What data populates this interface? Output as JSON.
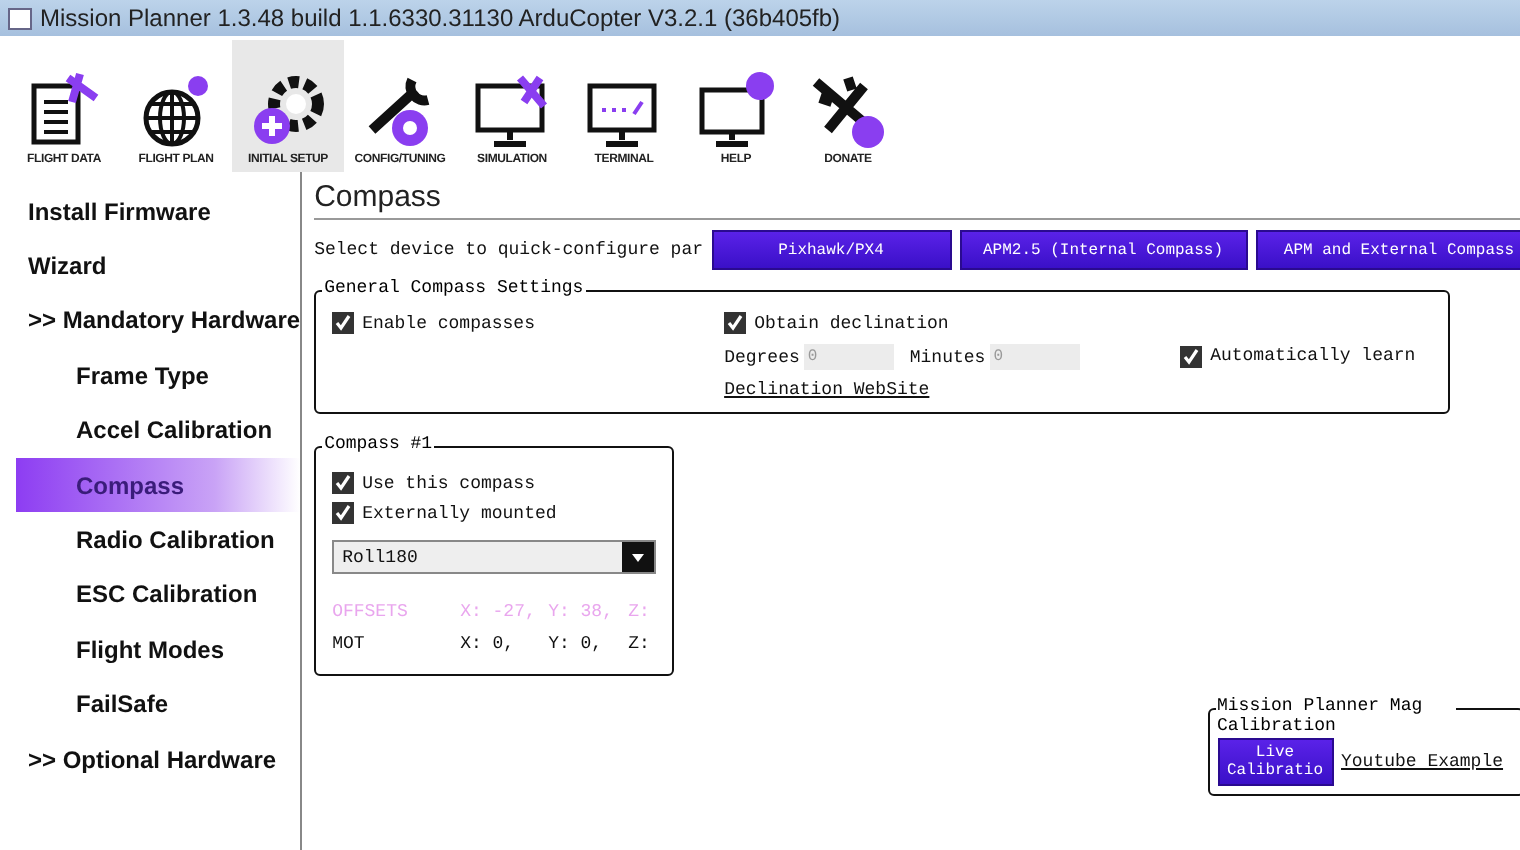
{
  "window": {
    "title": "Mission Planner 1.3.48 build 1.1.6330.31130 ArduCopter V3.2.1 (36b405fb)"
  },
  "toolbar": [
    {
      "label": "FLIGHT DATA",
      "kind": "document",
      "selected": false
    },
    {
      "label": "FLIGHT PLAN",
      "kind": "globe",
      "selected": false
    },
    {
      "label": "INITIAL SETUP",
      "kind": "gear",
      "selected": true
    },
    {
      "label": "CONFIG/TUNING",
      "kind": "wrench",
      "selected": false
    },
    {
      "label": "SIMULATION",
      "kind": "monitor-plane",
      "selected": false
    },
    {
      "label": "TERMINAL",
      "kind": "monitor-terminal",
      "selected": false
    },
    {
      "label": "HELP",
      "kind": "monitor-help",
      "selected": false
    },
    {
      "label": "DONATE",
      "kind": "plane-coin",
      "selected": false
    }
  ],
  "sidebar": {
    "items": [
      {
        "label": "Install Firmware",
        "selected": false
      },
      {
        "label": "Wizard",
        "selected": false
      },
      {
        "label": ">> Mandatory Hardware",
        "selected": false,
        "children": [
          {
            "label": "Frame Type",
            "selected": false
          },
          {
            "label": "Accel Calibration",
            "selected": false
          },
          {
            "label": "Compass",
            "selected": true
          },
          {
            "label": "Radio Calibration",
            "selected": false
          },
          {
            "label": "ESC Calibration",
            "selected": false
          },
          {
            "label": "Flight Modes",
            "selected": false
          },
          {
            "label": "FailSafe",
            "selected": false
          }
        ]
      },
      {
        "label": ">> Optional Hardware",
        "selected": false
      }
    ]
  },
  "page": {
    "title": "Compass",
    "quick_config": {
      "label": "Select device to quick-configure par",
      "buttons": [
        "Pixhawk/PX4",
        "APM2.5 (Internal Compass)",
        "APM and External Compass"
      ]
    },
    "general": {
      "title": "General Compass Settings",
      "enable": {
        "label": "Enable compasses",
        "checked": true
      },
      "obtain": {
        "label": "Obtain declination",
        "checked": true
      },
      "auto_learn": {
        "label": "Automatically learn",
        "checked": true
      },
      "degrees": {
        "label": "Degrees",
        "value": "0"
      },
      "minutes": {
        "label": "Minutes",
        "value": "0"
      },
      "link": "Declination WebSite"
    },
    "compass1": {
      "title": "Compass #1",
      "use": {
        "label": "Use this compass",
        "checked": true
      },
      "external": {
        "label": "Externally mounted",
        "checked": true
      },
      "orientation": "Roll180",
      "offsets": [
        "OFFSETS",
        "X: -27,",
        "Y: 38,",
        "Z:"
      ],
      "mot": [
        "MOT",
        "X: 0,",
        "Y: 0,",
        "Z:"
      ]
    },
    "mag_cal": {
      "title": "Mission Planner Mag Calibration",
      "button": "Live Calibratio",
      "link": "Youtube Example"
    }
  }
}
